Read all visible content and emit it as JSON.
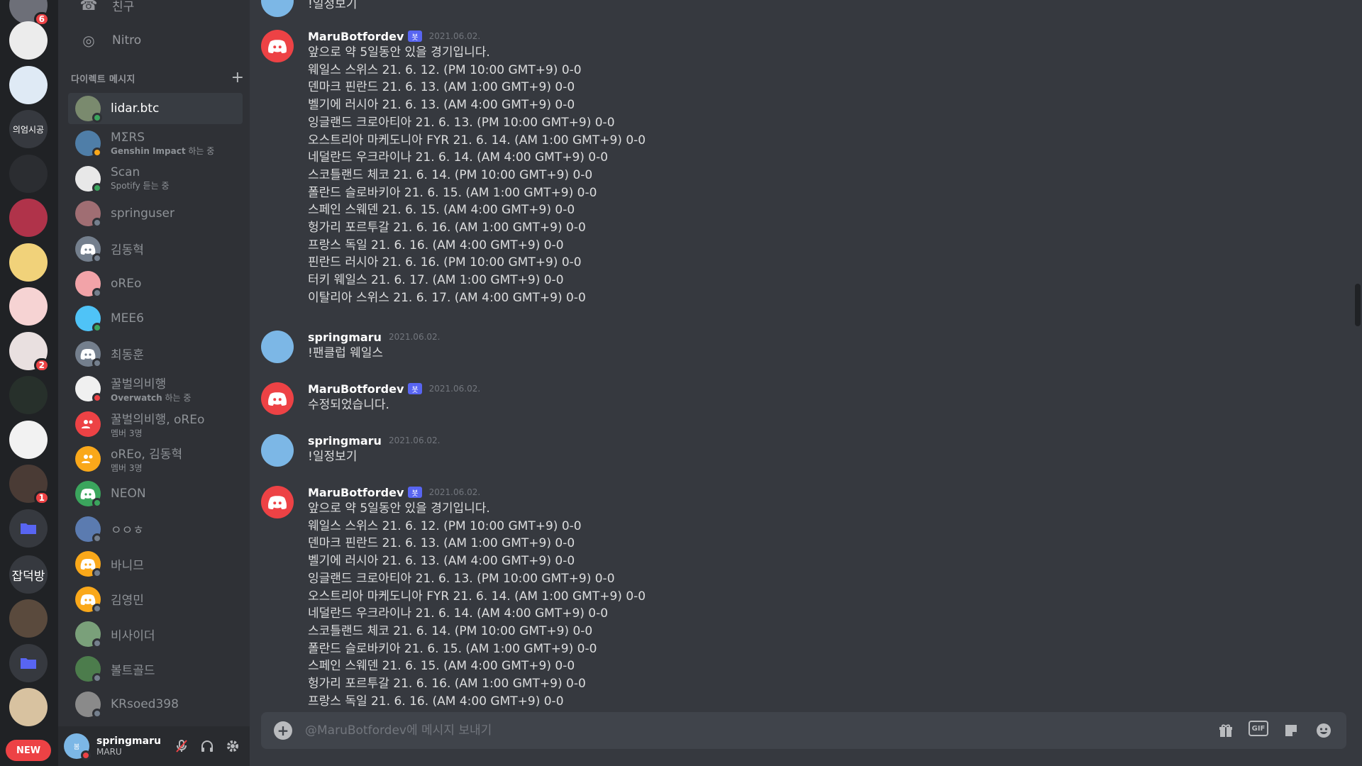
{
  "server_rail": {
    "servers": [
      {
        "label": "",
        "badge": "6",
        "color": "#6d6f78"
      },
      {
        "label": "",
        "badge": "",
        "color": "#ececec"
      },
      {
        "label": "",
        "badge": "",
        "color": "#dfeaf5"
      },
      {
        "label": "의엄시공",
        "badge": "",
        "color": "#36393f"
      },
      {
        "label": "",
        "badge": "",
        "color": "#2b2d31"
      },
      {
        "label": "",
        "badge": "",
        "color": "#b0334a"
      },
      {
        "label": "",
        "badge": "",
        "color": "#f1d27a"
      },
      {
        "label": "",
        "badge": "",
        "color": "#f6d3d3"
      },
      {
        "label": "",
        "badge": "2",
        "color": "#e9e0e0"
      },
      {
        "label": "",
        "badge": "",
        "color": "#27302b"
      },
      {
        "label": "",
        "badge": "",
        "color": "#f2f2f2"
      },
      {
        "label": "",
        "badge": "1",
        "color": "#4a3b35"
      },
      {
        "label": "",
        "badge": "",
        "color": "#36393f",
        "folder": true
      },
      {
        "label": "잡덕방",
        "badge": "",
        "color": "#36393f"
      },
      {
        "label": "",
        "badge": "",
        "color": "#5a4a3d"
      },
      {
        "label": "",
        "badge": "",
        "color": "#36393f",
        "folder": true
      },
      {
        "label": "",
        "badge": "",
        "color": "#d8c2a0"
      }
    ],
    "new_label": "NEW"
  },
  "sidebar": {
    "nav": [
      {
        "label": "친구",
        "icon": "friends-icon"
      },
      {
        "label": "Nitro",
        "icon": "nitro-icon"
      }
    ],
    "dm_header": "다이렉트 메시지",
    "dms": [
      {
        "name": "lidar.btc",
        "sub": "",
        "status": "online",
        "color": "#7a8a6e",
        "active": true
      },
      {
        "name": "MΣRS",
        "sub_bold": "Genshin Impact",
        "sub": " 하는 중",
        "status": "idle",
        "color": "#4f7ea8"
      },
      {
        "name": "Scan",
        "sub": "Spotify 듣는 중",
        "status": "online",
        "color": "#e8e8e8"
      },
      {
        "name": "springuser",
        "sub": "",
        "status": "offline",
        "color": "#a06e73"
      },
      {
        "name": "김동혁",
        "sub": "",
        "status": "offline",
        "color": "#747f8d"
      },
      {
        "name": "oREo",
        "sub": "",
        "status": "offline",
        "color": "#f2a3a8"
      },
      {
        "name": "MEE6",
        "sub": "",
        "status": "online",
        "color": "#4fc3f7"
      },
      {
        "name": "최동훈",
        "sub": "",
        "status": "offline",
        "color": "#747f8d"
      },
      {
        "name": "꿀벌의비행",
        "sub_bold": "Overwatch",
        "sub": " 하는 중",
        "status": "dnd",
        "color": "#f0f0f0"
      },
      {
        "name": "꿀벌의비행, oREo",
        "sub": "멤버 3명",
        "status": "",
        "color": "#ed4245",
        "group": true
      },
      {
        "name": "oREo, 김동혁",
        "sub": "멤버 3명",
        "status": "",
        "color": "#faa81a",
        "group": true
      },
      {
        "name": "NEON",
        "sub": "",
        "status": "online",
        "color": "#3ba55d"
      },
      {
        "name": "ㅇㅇㅎ",
        "sub": "",
        "status": "offline",
        "color": "#5b7bb0"
      },
      {
        "name": "바니므",
        "sub": "",
        "status": "offline",
        "color": "#faa81a"
      },
      {
        "name": "김영민",
        "sub": "",
        "status": "offline",
        "color": "#faa81a"
      },
      {
        "name": "비사이더",
        "sub": "",
        "status": "offline",
        "color": "#7aa07a"
      },
      {
        "name": "볼트골드",
        "sub": "",
        "status": "offline",
        "color": "#4c7c4c"
      },
      {
        "name": "KRsoed398",
        "sub": "",
        "status": "offline",
        "color": "#8a8a8a"
      }
    ]
  },
  "user_panel": {
    "name": "springmaru",
    "tag": "MARU"
  },
  "chat": {
    "top_partial_text": "!일정보기",
    "messages": [
      {
        "author": "MaruBotfordev",
        "bot": true,
        "bot_label": "봇",
        "timestamp": "2021.06.02.",
        "lines": [
          "앞으로 약 5일동안 있을 경기입니다.",
          "웨일스 스위스 21. 6. 12. (PM 10:00 GMT+9) 0-0",
          "덴마크 핀란드 21. 6. 13. (AM 1:00 GMT+9) 0-0",
          "벨기에 러시아 21. 6. 13. (AM 4:00 GMT+9) 0-0",
          "잉글랜드 크로아티아 21. 6. 13. (PM 10:00 GMT+9) 0-0",
          "오스트리아 마케도니아 FYR 21. 6. 14. (AM 1:00 GMT+9) 0-0",
          "네덜란드 우크라이나 21. 6. 14. (AM 4:00 GMT+9) 0-0",
          "스코틀랜드 체코 21. 6. 14. (PM 10:00 GMT+9) 0-0",
          "폴란드 슬로바키아 21. 6. 15. (AM 1:00 GMT+9) 0-0",
          "스페인 스웨덴 21. 6. 15. (AM 4:00 GMT+9) 0-0",
          "헝가리 포르투갈 21. 6. 16. (AM 1:00 GMT+9) 0-0",
          "프랑스 독일 21. 6. 16. (AM 4:00 GMT+9) 0-0",
          "핀란드 러시아 21. 6. 16. (PM 10:00 GMT+9) 0-0",
          "터키 웨일스 21. 6. 17. (AM 1:00 GMT+9) 0-0",
          "이탈리아 스위스 21. 6. 17. (AM 4:00 GMT+9) 0-0"
        ]
      },
      {
        "author": "springmaru",
        "bot": false,
        "timestamp": "2021.06.02.",
        "lines": [
          "!팬클럽 웨일스"
        ]
      },
      {
        "author": "MaruBotfordev",
        "bot": true,
        "bot_label": "봇",
        "timestamp": "2021.06.02.",
        "lines": [
          "수정되었습니다."
        ]
      },
      {
        "author": "springmaru",
        "bot": false,
        "timestamp": "2021.06.02.",
        "lines": [
          "!일정보기"
        ]
      },
      {
        "author": "MaruBotfordev",
        "bot": true,
        "bot_label": "봇",
        "timestamp": "2021.06.02.",
        "lines": [
          "앞으로 약 5일동안 있을 경기입니다.",
          "웨일스 스위스 21. 6. 12. (PM 10:00 GMT+9) 0-0",
          "덴마크 핀란드 21. 6. 13. (AM 1:00 GMT+9) 0-0",
          "벨기에 러시아 21. 6. 13. (AM 4:00 GMT+9) 0-0",
          "잉글랜드 크로아티아 21. 6. 13. (PM 10:00 GMT+9) 0-0",
          "오스트리아 마케도니아 FYR 21. 6. 14. (AM 1:00 GMT+9) 0-0",
          "네덜란드 우크라이나 21. 6. 14. (AM 4:00 GMT+9) 0-0",
          "스코틀랜드 체코 21. 6. 14. (PM 10:00 GMT+9) 0-0",
          "폴란드 슬로바키아 21. 6. 15. (AM 1:00 GMT+9) 0-0",
          "스페인 스웨덴 21. 6. 15. (AM 4:00 GMT+9) 0-0",
          "헝가리 포르투갈 21. 6. 16. (AM 1:00 GMT+9) 0-0",
          "프랑스 독일 21. 6. 16. (AM 4:00 GMT+9) 0-0"
        ]
      }
    ]
  },
  "composer": {
    "placeholder": "@MaruBotfordev에 메시지 보내기",
    "gif_label": "GIF"
  },
  "colors": {
    "bot_avatar": "#ed4245",
    "user_avatar": "#7cb7e6",
    "bot_tag": "#5865f2",
    "online": "#3ba55d"
  }
}
